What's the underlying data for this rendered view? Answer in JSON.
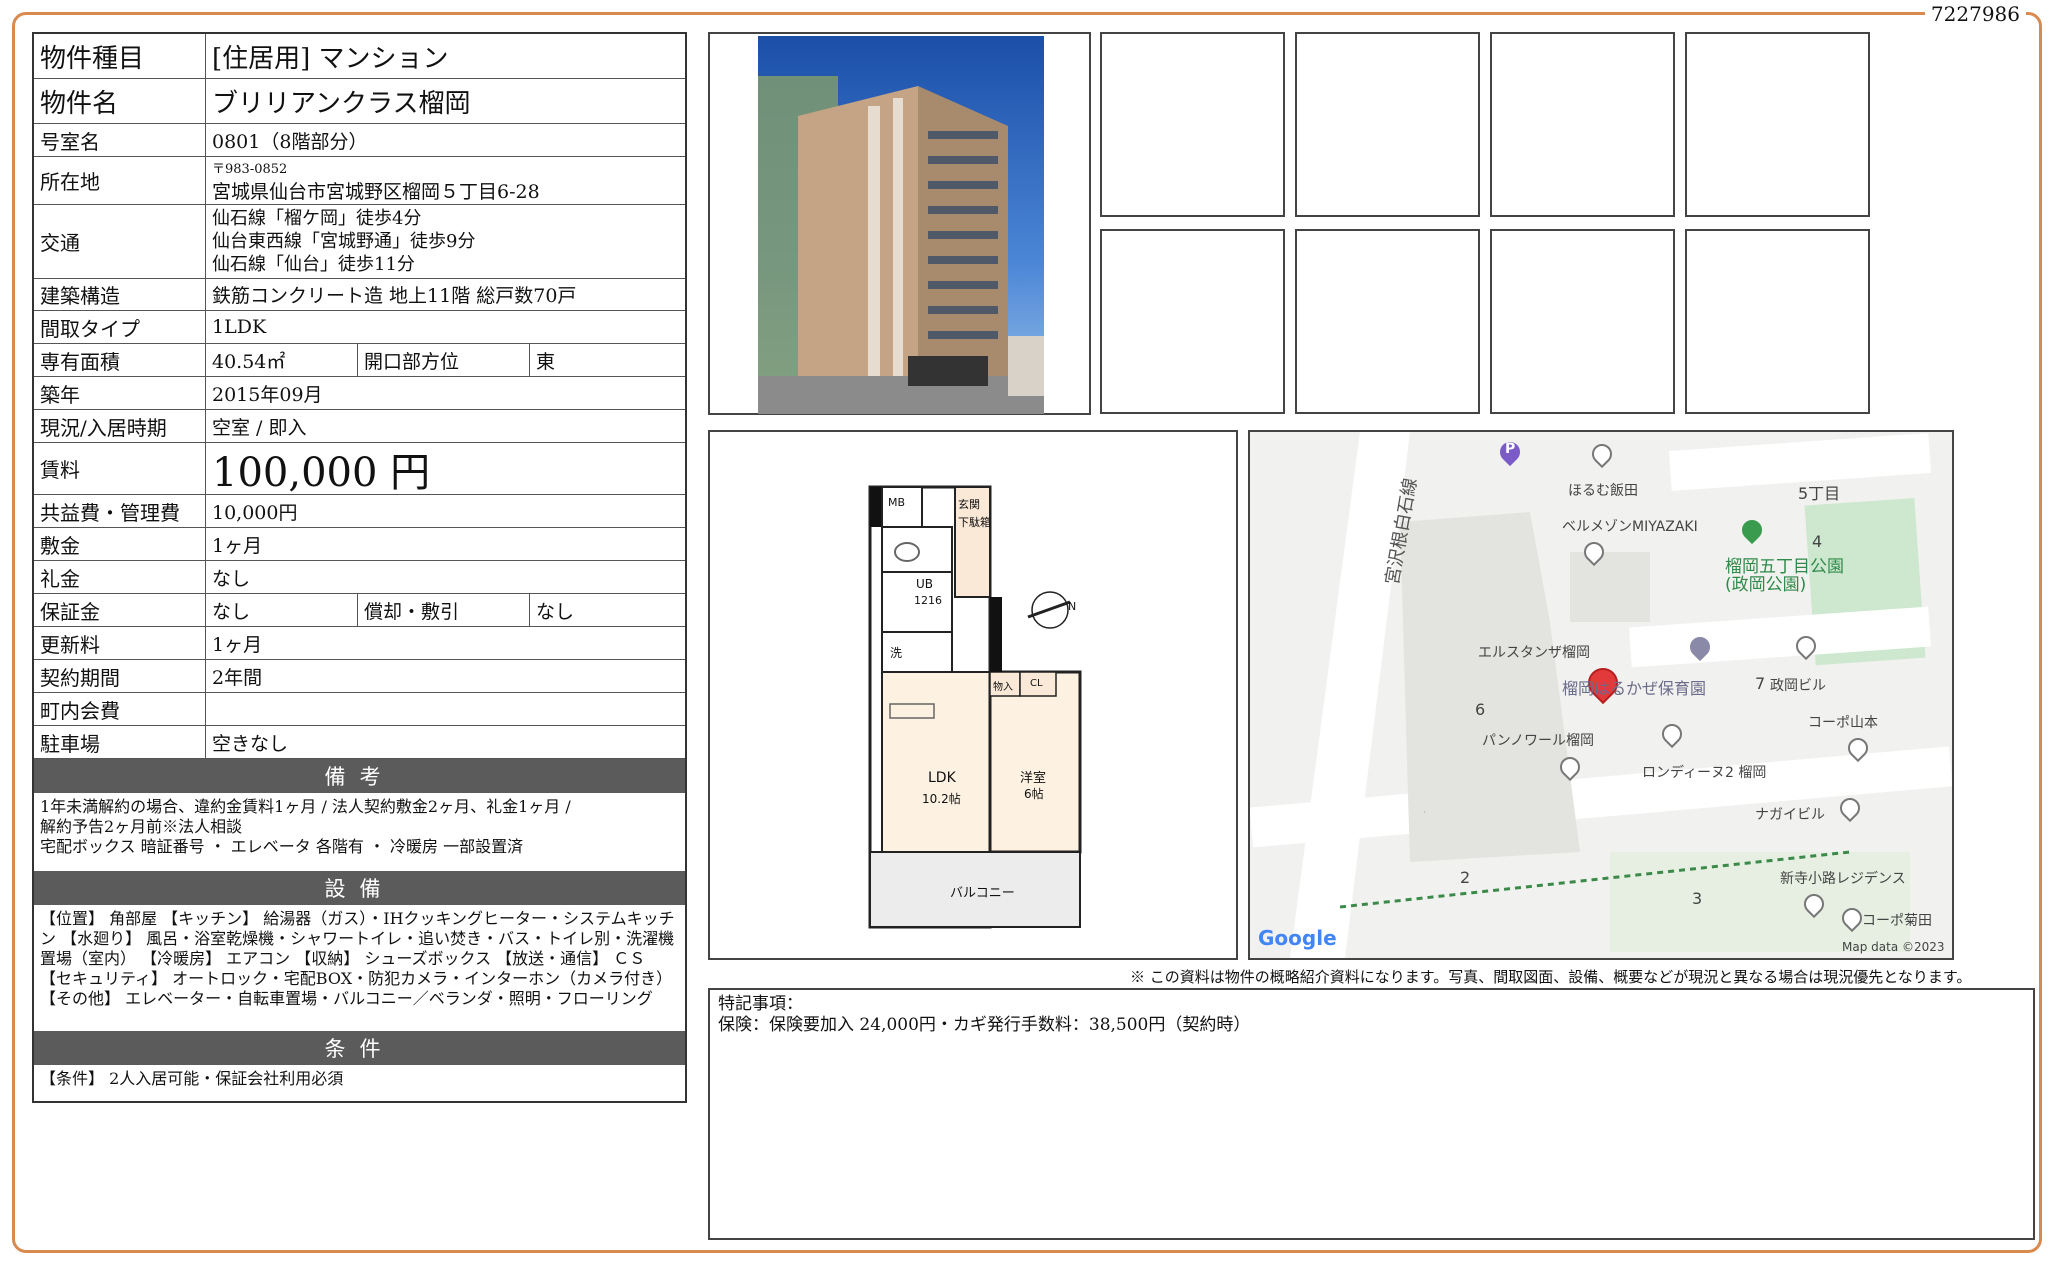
{
  "doc_number": "7227986",
  "spec": {
    "type_label": "物件種目",
    "type_value": "[住居用]  マンション",
    "name_label": "物件名",
    "name_value": "ブリリアンクラス榴岡",
    "room_label": "号室名",
    "room_value": "0801（8階部分）",
    "address_label": "所在地",
    "address_zip": "〒983-0852",
    "address_value": "宮城県仙台市宮城野区榴岡５丁目6-28",
    "access_label": "交通",
    "access_1": "仙石線「榴ケ岡」徒歩4分",
    "access_2": "仙台東西線「宮城野通」徒歩9分",
    "access_3": "仙石線「仙台」徒歩11分",
    "structure_label": "建築構造",
    "structure_value": "鉄筋コンクリート造  地上11階  総戸数70戸",
    "layout_label": "間取タイプ",
    "layout_value": "1LDK",
    "area_label": "専有面積",
    "area_value": "40.54㎡",
    "direction_label": "開口部方位",
    "direction_value": "東",
    "built_label": "築年",
    "built_value": "2015年09月",
    "status_label": "現況/入居時期",
    "status_value": "空室  /  即入",
    "rent_label": "賃料",
    "rent_value": "100,000 円",
    "fee_label": "共益費・管理費",
    "fee_value": "10,000円",
    "deposit_label": "敷金",
    "deposit_value": "1ヶ月",
    "key_money_label": "礼金",
    "key_money_value": "なし",
    "guarantee_label": "保証金",
    "guarantee_value": "なし",
    "amort_label": "償却・敷引",
    "amort_value": "なし",
    "renewal_label": "更新料",
    "renewal_value": "1ヶ月",
    "contract_label": "契約期間",
    "contract_value": "2年間",
    "town_fee_label": "町内会費",
    "town_fee_value": "",
    "parking_label": "駐車場",
    "parking_value": "空きなし"
  },
  "remarks": {
    "head": "備考",
    "line1": "1年未満解約の場合、違約金賃料1ヶ月  /  法人契約敷金2ヶ月、礼金1ヶ月  /",
    "line2": "解約予告2ヶ月前※法人相談",
    "line3": "宅配ボックス  暗証番号  ・  エレベータ  各階有  ・  冷暖房  一部設置済"
  },
  "equipment": {
    "head": "設備",
    "text": "【位置】 角部屋 【キッチン】 給湯器（ガス）・IHクッキングヒーター・システムキッチン 【水廻り】 風呂・浴室乾燥機・シャワートイレ・追い焚き・バス・トイレ別・洗濯機置場（室内） 【冷暖房】 エアコン 【収納】 シューズボックス 【放送・通信】 ＣＳ 【セキュリティ】 オートロック・宅配BOX・防犯カメラ・インターホン（カメラ付き） 【その他】 エレベーター・自転車置場・バルコニー／ベランダ・照明・フローリング"
  },
  "conditions": {
    "head": "条件",
    "text": "【条件】 2人入居可能・保証会社利用必須"
  },
  "floorplan": {
    "mb": "MB",
    "genkan": "玄関",
    "gekobako": "下駄箱",
    "ub": "UB",
    "ub_size": "1216",
    "wash": "洗",
    "ldk": "LDK",
    "ldk_size": "10.2帖",
    "nyu": "物入",
    "cl": "CL",
    "yoshitsu": "洋室",
    "yoshitsu_size": "6帖",
    "balcony": "バルコニー",
    "north": "N"
  },
  "map": {
    "street": "宮沢根白石線",
    "chome5": "5丁目",
    "n4": "4",
    "n6": "6",
    "n7": "7",
    "n2": "2",
    "n3": "3",
    "horumu": "ほるむ飯田",
    "bell": "ベルメゾンMIYAZAKI",
    "park": "榴岡五丁目公園(政岡公園)",
    "elstanza": "エルスタンザ榴岡",
    "hoikuen": "榴岡はるかぜ保育園",
    "masaoka": "政岡ビル",
    "pannoir": "パンノワール榴岡",
    "rondine": "ロンディーヌ2 榴岡",
    "corpo_yama": "コーポ山本",
    "nagai": "ナガイビル",
    "shinji": "新寺小路レジデンス",
    "corpo_kiku": "コーポ菊田",
    "google": "Google",
    "mapdata": "Map data ©2023",
    "parking_icon": "P"
  },
  "disclaimer": "※ この資料は物件の概略紹介資料になります。写真、間取図面、設備、概要などが現況と異なる場合は現況優先となります。",
  "special": {
    "label": "特記事項：",
    "text": "保険：保険要加入 24,000円・カギ発行手数料：38,500円（契約時）"
  }
}
